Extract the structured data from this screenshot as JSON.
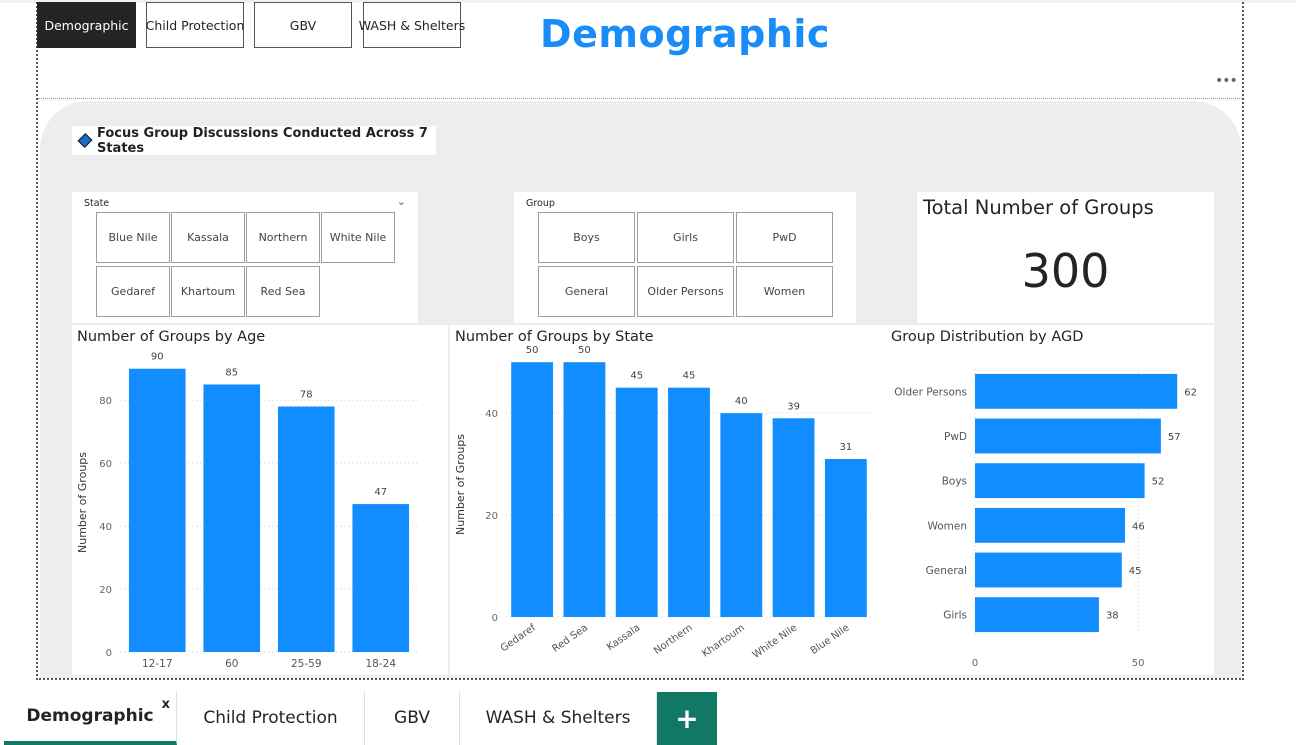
{
  "nav": {
    "buttons": [
      {
        "label": "Demographic",
        "active": true
      },
      {
        "label": "Child Protection",
        "active": false
      },
      {
        "label": "GBV",
        "active": false
      },
      {
        "label": "WASH & Shelters",
        "active": false
      }
    ]
  },
  "page_title": "Demographic",
  "more_options_icon": "ellipsis-icon",
  "focus_text": "Focus Group Discussions Conducted Across 7 States",
  "state_slicer": {
    "title": "State",
    "items": [
      "Blue Nile",
      "Kassala",
      "Northern",
      "White Nile",
      "Gedaref",
      "Khartoum",
      "Red Sea"
    ]
  },
  "group_slicer": {
    "title": "Group",
    "items": [
      "Boys",
      "Girls",
      "PwD",
      "General",
      "Older Persons",
      "Women"
    ]
  },
  "kpi": {
    "label": "Total Number of Groups",
    "value": "300"
  },
  "colors": {
    "accent": "#1a8cf7",
    "bar": "#118dff",
    "tab_accent": "#117865",
    "panel": "#ededed"
  },
  "chart_data": [
    {
      "type": "bar",
      "title": "Number of Groups by Age",
      "ylabel": "Number of Groups",
      "categories": [
        "12-17",
        "60",
        "25-59",
        "18-24"
      ],
      "values": [
        90,
        85,
        78,
        47
      ],
      "ylim": [
        0,
        95
      ],
      "yticks": [
        0,
        20,
        40,
        60,
        80
      ],
      "grid": true
    },
    {
      "type": "bar",
      "title": "Number of Groups by State",
      "ylabel": "Number of Groups",
      "categories": [
        "Gedaref",
        "Red Sea",
        "Kassala",
        "Northern",
        "Khartoum",
        "White Nile",
        "Blue Nile"
      ],
      "values": [
        50,
        50,
        45,
        45,
        40,
        39,
        31
      ],
      "ylim": [
        0,
        52
      ],
      "yticks": [
        0,
        20,
        40
      ],
      "grid": true
    },
    {
      "type": "bar",
      "orientation": "horizontal",
      "title": "Group Distribution by AGD",
      "categories": [
        "Older Persons",
        "PwD",
        "Boys",
        "Women",
        "General",
        "Girls"
      ],
      "values": [
        62,
        57,
        52,
        46,
        45,
        38
      ],
      "xlim": [
        0,
        65
      ],
      "xticks": [
        0,
        50
      ],
      "grid": true
    }
  ],
  "tabs": [
    {
      "label": "Demographic",
      "active": true,
      "close": "x"
    },
    {
      "label": "Child Protection",
      "active": false
    },
    {
      "label": "GBV",
      "active": false
    },
    {
      "label": "WASH & Shelters",
      "active": false
    }
  ],
  "add_tab_icon": "plus-icon",
  "add_tab_glyph": "+"
}
